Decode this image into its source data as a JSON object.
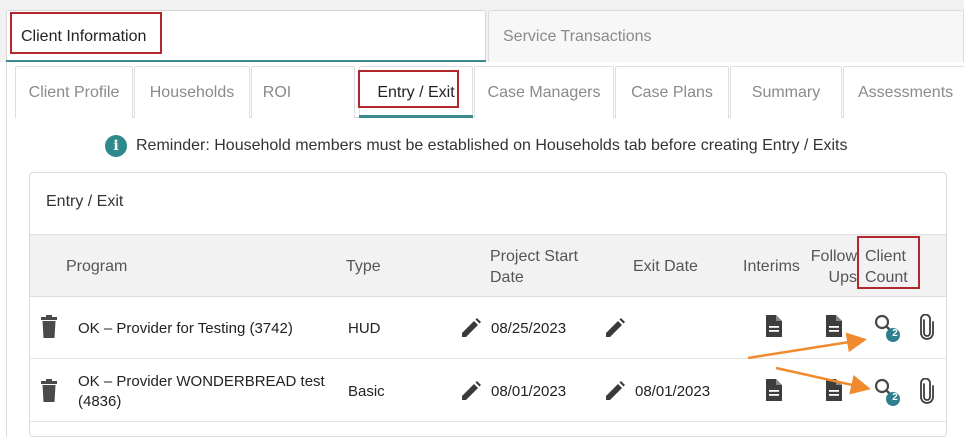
{
  "top_tabs": [
    {
      "label": "Client Information",
      "active": true
    },
    {
      "label": "Service Transactions",
      "active": false
    }
  ],
  "sub_tabs": [
    {
      "label": "Client Profile"
    },
    {
      "label": "Households"
    },
    {
      "label": "ROI"
    },
    {
      "label": "Entry / Exit",
      "active": true
    },
    {
      "label": "Case Managers"
    },
    {
      "label": "Case Plans"
    },
    {
      "label": "Summary"
    },
    {
      "label": "Assessments"
    }
  ],
  "reminder": "Reminder: Household members must be established on Households tab before creating Entry / Exits",
  "card_title": "Entry / Exit",
  "columns": {
    "program": "Program",
    "type": "Type",
    "start_line1": "Project Start",
    "start_line2": "Date",
    "exit": "Exit Date",
    "interims": "Interims",
    "follow_line1": "Follow",
    "follow_line2": "Ups",
    "count_line1": "Client",
    "count_line2": "Count"
  },
  "rows": [
    {
      "program_line1": "OK – Provider for Testing (3742)",
      "program_line2": "",
      "type": "HUD",
      "start_date": "08/25/2023",
      "exit_date": "",
      "client_count": "2"
    },
    {
      "program_line1": "OK – Provider WONDERBREAD test",
      "program_line2": "(4836)",
      "type": "Basic",
      "start_date": "08/01/2023",
      "exit_date": "08/01/2023",
      "client_count": "2"
    }
  ],
  "colors": {
    "accent": "#3a8a8e",
    "highlight_box": "#b3262b",
    "arrow": "#f08a2c",
    "badge": "#2f7f8f"
  }
}
